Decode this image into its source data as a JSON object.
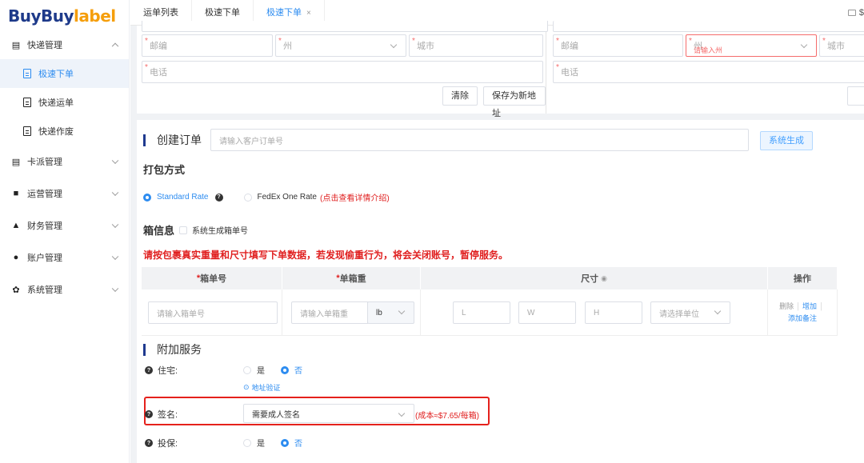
{
  "brand": {
    "part1": "BuyBuy",
    "part2": "label"
  },
  "sidebar": {
    "groups": [
      {
        "label": "快递管理",
        "expanded": true,
        "items": [
          {
            "label": "极速下单",
            "active": true
          },
          {
            "label": "快递运单",
            "active": false
          },
          {
            "label": "快递作废",
            "active": false
          }
        ]
      },
      {
        "label": "卡派管理",
        "expanded": false
      },
      {
        "label": "运营管理",
        "expanded": false
      },
      {
        "label": "财务管理",
        "expanded": false
      },
      {
        "label": "账户管理",
        "expanded": false
      },
      {
        "label": "系统管理",
        "expanded": false
      }
    ]
  },
  "tabs": [
    {
      "label": "运单列表",
      "active": false
    },
    {
      "label": "极速下单",
      "active": false
    },
    {
      "label": "极速下单",
      "active": true,
      "close": "×"
    }
  ],
  "topright": {
    "text": "$"
  },
  "address_left": {
    "zip_placeholder": "邮编",
    "state_placeholder": "州",
    "city_placeholder": "城市",
    "phone_placeholder": "电话",
    "clear_label": "清除",
    "save_label": "保存为新地址"
  },
  "address_right": {
    "zip_placeholder": "邮编",
    "state_placeholder": "州",
    "state_error": "请输入州",
    "city_placeholder": "城市",
    "phone_placeholder": "电话"
  },
  "order": {
    "title": "创建订单",
    "customer_no_placeholder": "请输入客户订单号",
    "generate_label": "系统生成"
  },
  "packing": {
    "title": "打包方式",
    "options": [
      {
        "label": "Standard Rate",
        "selected": true
      },
      {
        "label": "FedEx One Rate",
        "selected": false,
        "note": "(点击查看详情介绍)"
      }
    ]
  },
  "box": {
    "title": "箱信息",
    "auto_label": "系统生成箱单号",
    "warning": "请按包裹真实重量和尺寸填写下单数据，若发现偷重行为，将会关闭账号，暂停服务。",
    "headers": {
      "box_no": "箱单号",
      "weight": "单箱重",
      "size": "尺寸",
      "actions": "操作"
    },
    "row": {
      "box_no_placeholder": "请输入箱单号",
      "weight_placeholder": "请输入单箱重",
      "weight_unit": "lb",
      "l": "L",
      "w": "W",
      "h": "H",
      "unit_placeholder": "请选择单位",
      "delete": "删除",
      "add": "增加",
      "remark": "添加备注"
    }
  },
  "services": {
    "title": "附加服务",
    "residential": {
      "label": "住宅:",
      "yes": "是",
      "no": "否",
      "selected": "no",
      "verify": "地址验证"
    },
    "signature": {
      "label": "签名:",
      "value": "需要成人签名",
      "cost": "(成本≈$7.65/每箱)"
    },
    "insurance": {
      "label": "投保:",
      "yes": "是",
      "no": "否",
      "selected": "no"
    }
  }
}
